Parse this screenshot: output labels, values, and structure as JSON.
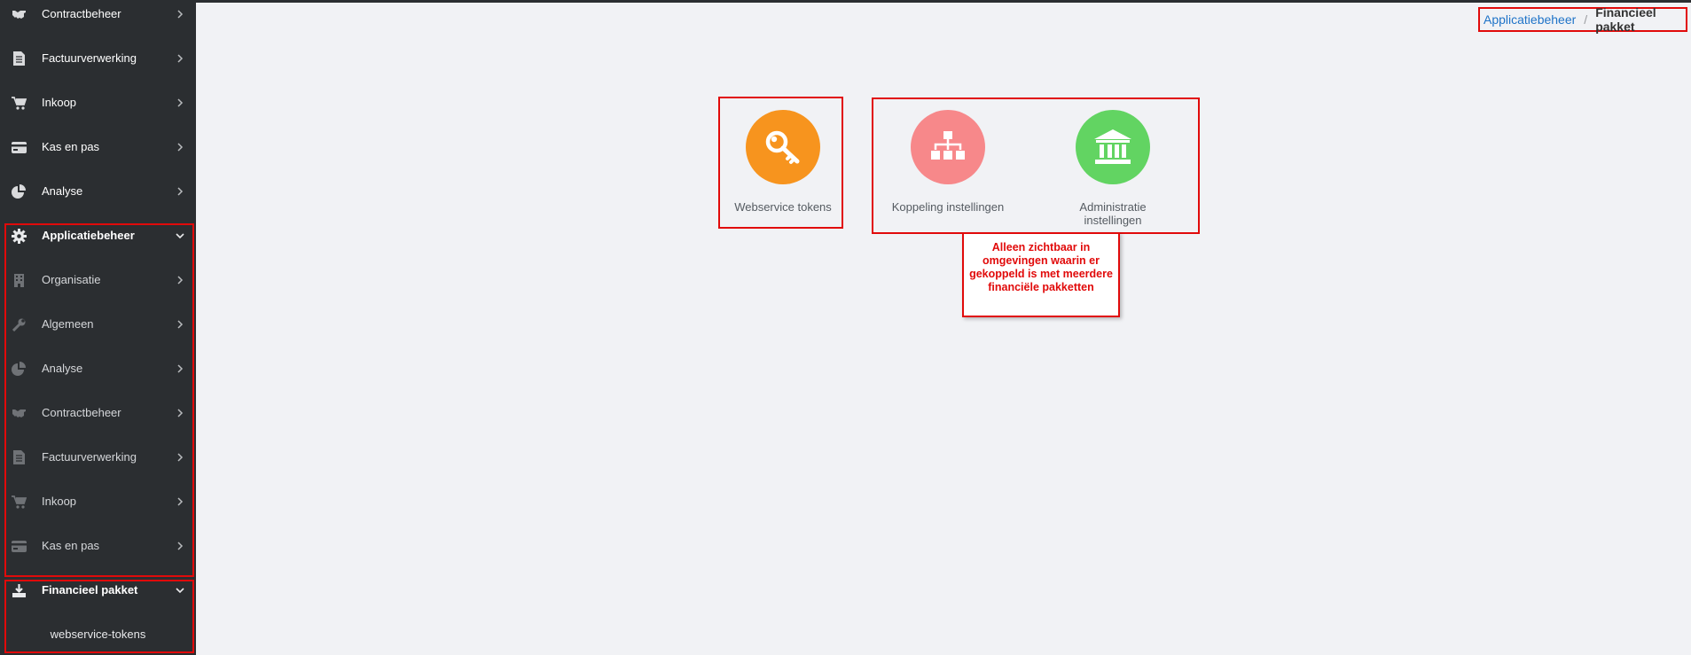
{
  "sidebar": {
    "items": [
      {
        "label": "Contractbeheer",
        "icon": "handshake-icon"
      },
      {
        "label": "Factuurverwerking",
        "icon": "document-icon"
      },
      {
        "label": "Inkoop",
        "icon": "cart-icon"
      },
      {
        "label": "Kas en pas",
        "icon": "credit-card-icon"
      },
      {
        "label": "Analyse",
        "icon": "pie-chart-icon"
      }
    ],
    "group": {
      "label": "Applicatiebeheer",
      "icon": "gear-icon",
      "children": [
        {
          "label": "Organisatie",
          "icon": "building-icon"
        },
        {
          "label": "Algemeen",
          "icon": "wrench-icon"
        },
        {
          "label": "Analyse",
          "icon": "pie-chart-icon"
        },
        {
          "label": "Contractbeheer",
          "icon": "handshake-icon"
        },
        {
          "label": "Factuurverwerking",
          "icon": "document-icon"
        },
        {
          "label": "Inkoop",
          "icon": "cart-icon"
        },
        {
          "label": "Kas en pas",
          "icon": "credit-card-icon"
        }
      ]
    },
    "financial": {
      "label": "Financieel pakket",
      "icon": "download-icon",
      "leaf": "webservice-tokens"
    }
  },
  "breadcrumb": {
    "parent": "Applicatiebeheer",
    "separator": "/",
    "current": "Financieel pakket"
  },
  "tiles": [
    {
      "label": "Webservice tokens",
      "icon": "key-icon",
      "color": "#f7941e"
    },
    {
      "label": "Koppeling instellingen",
      "icon": "sitemap-icon",
      "color": "#f7888a"
    },
    {
      "label": "Administratie instellingen",
      "icon": "bank-icon",
      "color": "#62d462"
    }
  ],
  "note": "Alleen zichtbaar in omgevingen waarin er gekoppeld is met meerdere financiële pakketten",
  "colors": {
    "sidebar_bg": "#2b2e31",
    "page_bg": "#f1f2f5",
    "annotation_red": "#e10a0a",
    "link_blue": "#1e73c8"
  }
}
